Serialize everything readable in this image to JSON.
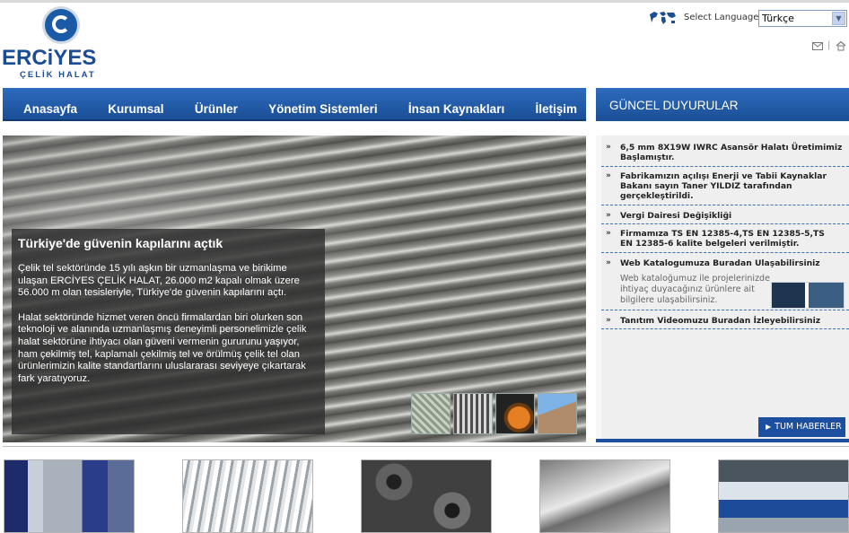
{
  "brand": {
    "name": "ERCiYES",
    "tagline": "ÇELİK HALAT"
  },
  "language": {
    "label": "Select Language",
    "selected": "Türkçe"
  },
  "header_icons": [
    "mail-icon",
    "home-icon"
  ],
  "nav": {
    "items": [
      {
        "label": "Anasayfa"
      },
      {
        "label": "Kurumsal"
      },
      {
        "label": "Ürünler"
      },
      {
        "label": "Yönetim Sistemleri"
      },
      {
        "label": "İnsan Kaynakları"
      },
      {
        "label": "İletişim"
      }
    ]
  },
  "hero": {
    "title": "Türkiye'de güvenin kapılarını açtık",
    "p1": "Çelik tel sektöründe 15 yılı aşkın bir uzmanlaşma ve birikime ulaşan ERCİYES ÇELİK HALAT, 26.000 m2 kapalı olmak üzere 56.000 m olan tesisleriyle, Türkiye'de güvenin kapılarını açtı.",
    "p2": "Halat sektöründe hizmet veren öncü firmalardan biri olurken son teknoloji ve alanında uzmanlaşmış deneyimli personelimizle çelik halat sektörüne ihtiyacı olan güveni vermenin gururunu yaşıyor, ham çekilmiş tel, kaplamalı çekilmiş tel ve örülmüş çelik tel olan ürünlerimizin kalite standartlarını uluslararası seviyeye çıkartarak fark yaratıyoruz."
  },
  "announcements": {
    "header": "GÜNCEL DUYURULAR",
    "items": [
      {
        "title": "6,5 mm 8X19W IWRC Asansör Halatı Üretimimiz Başlamıştır."
      },
      {
        "title": "Fabrikamızın açılışı Enerji ve Tabii Kaynaklar Bakanı sayın Taner YILDIZ tarafından gerçekleştirildi."
      },
      {
        "title": "Vergi Dairesi Değişikliği"
      },
      {
        "title": "Firmamıza TS EN 12385-4,TS EN 12385-5,TS EN 12385-6 kalite belgeleri verilmiştir."
      },
      {
        "title": "Web Katalogumuza Buradan Ulaşabilirsiniz",
        "sub": "Web kataloğumuz ile projelerinizde ihtiyaç duyacağınız ürünlere ait bilgilere ulaşabilirsiniz."
      },
      {
        "title": "Tanıtım Videomuzu Buradan İzleyebilirsiniz"
      }
    ],
    "all_news": "TUM HABERLER"
  }
}
